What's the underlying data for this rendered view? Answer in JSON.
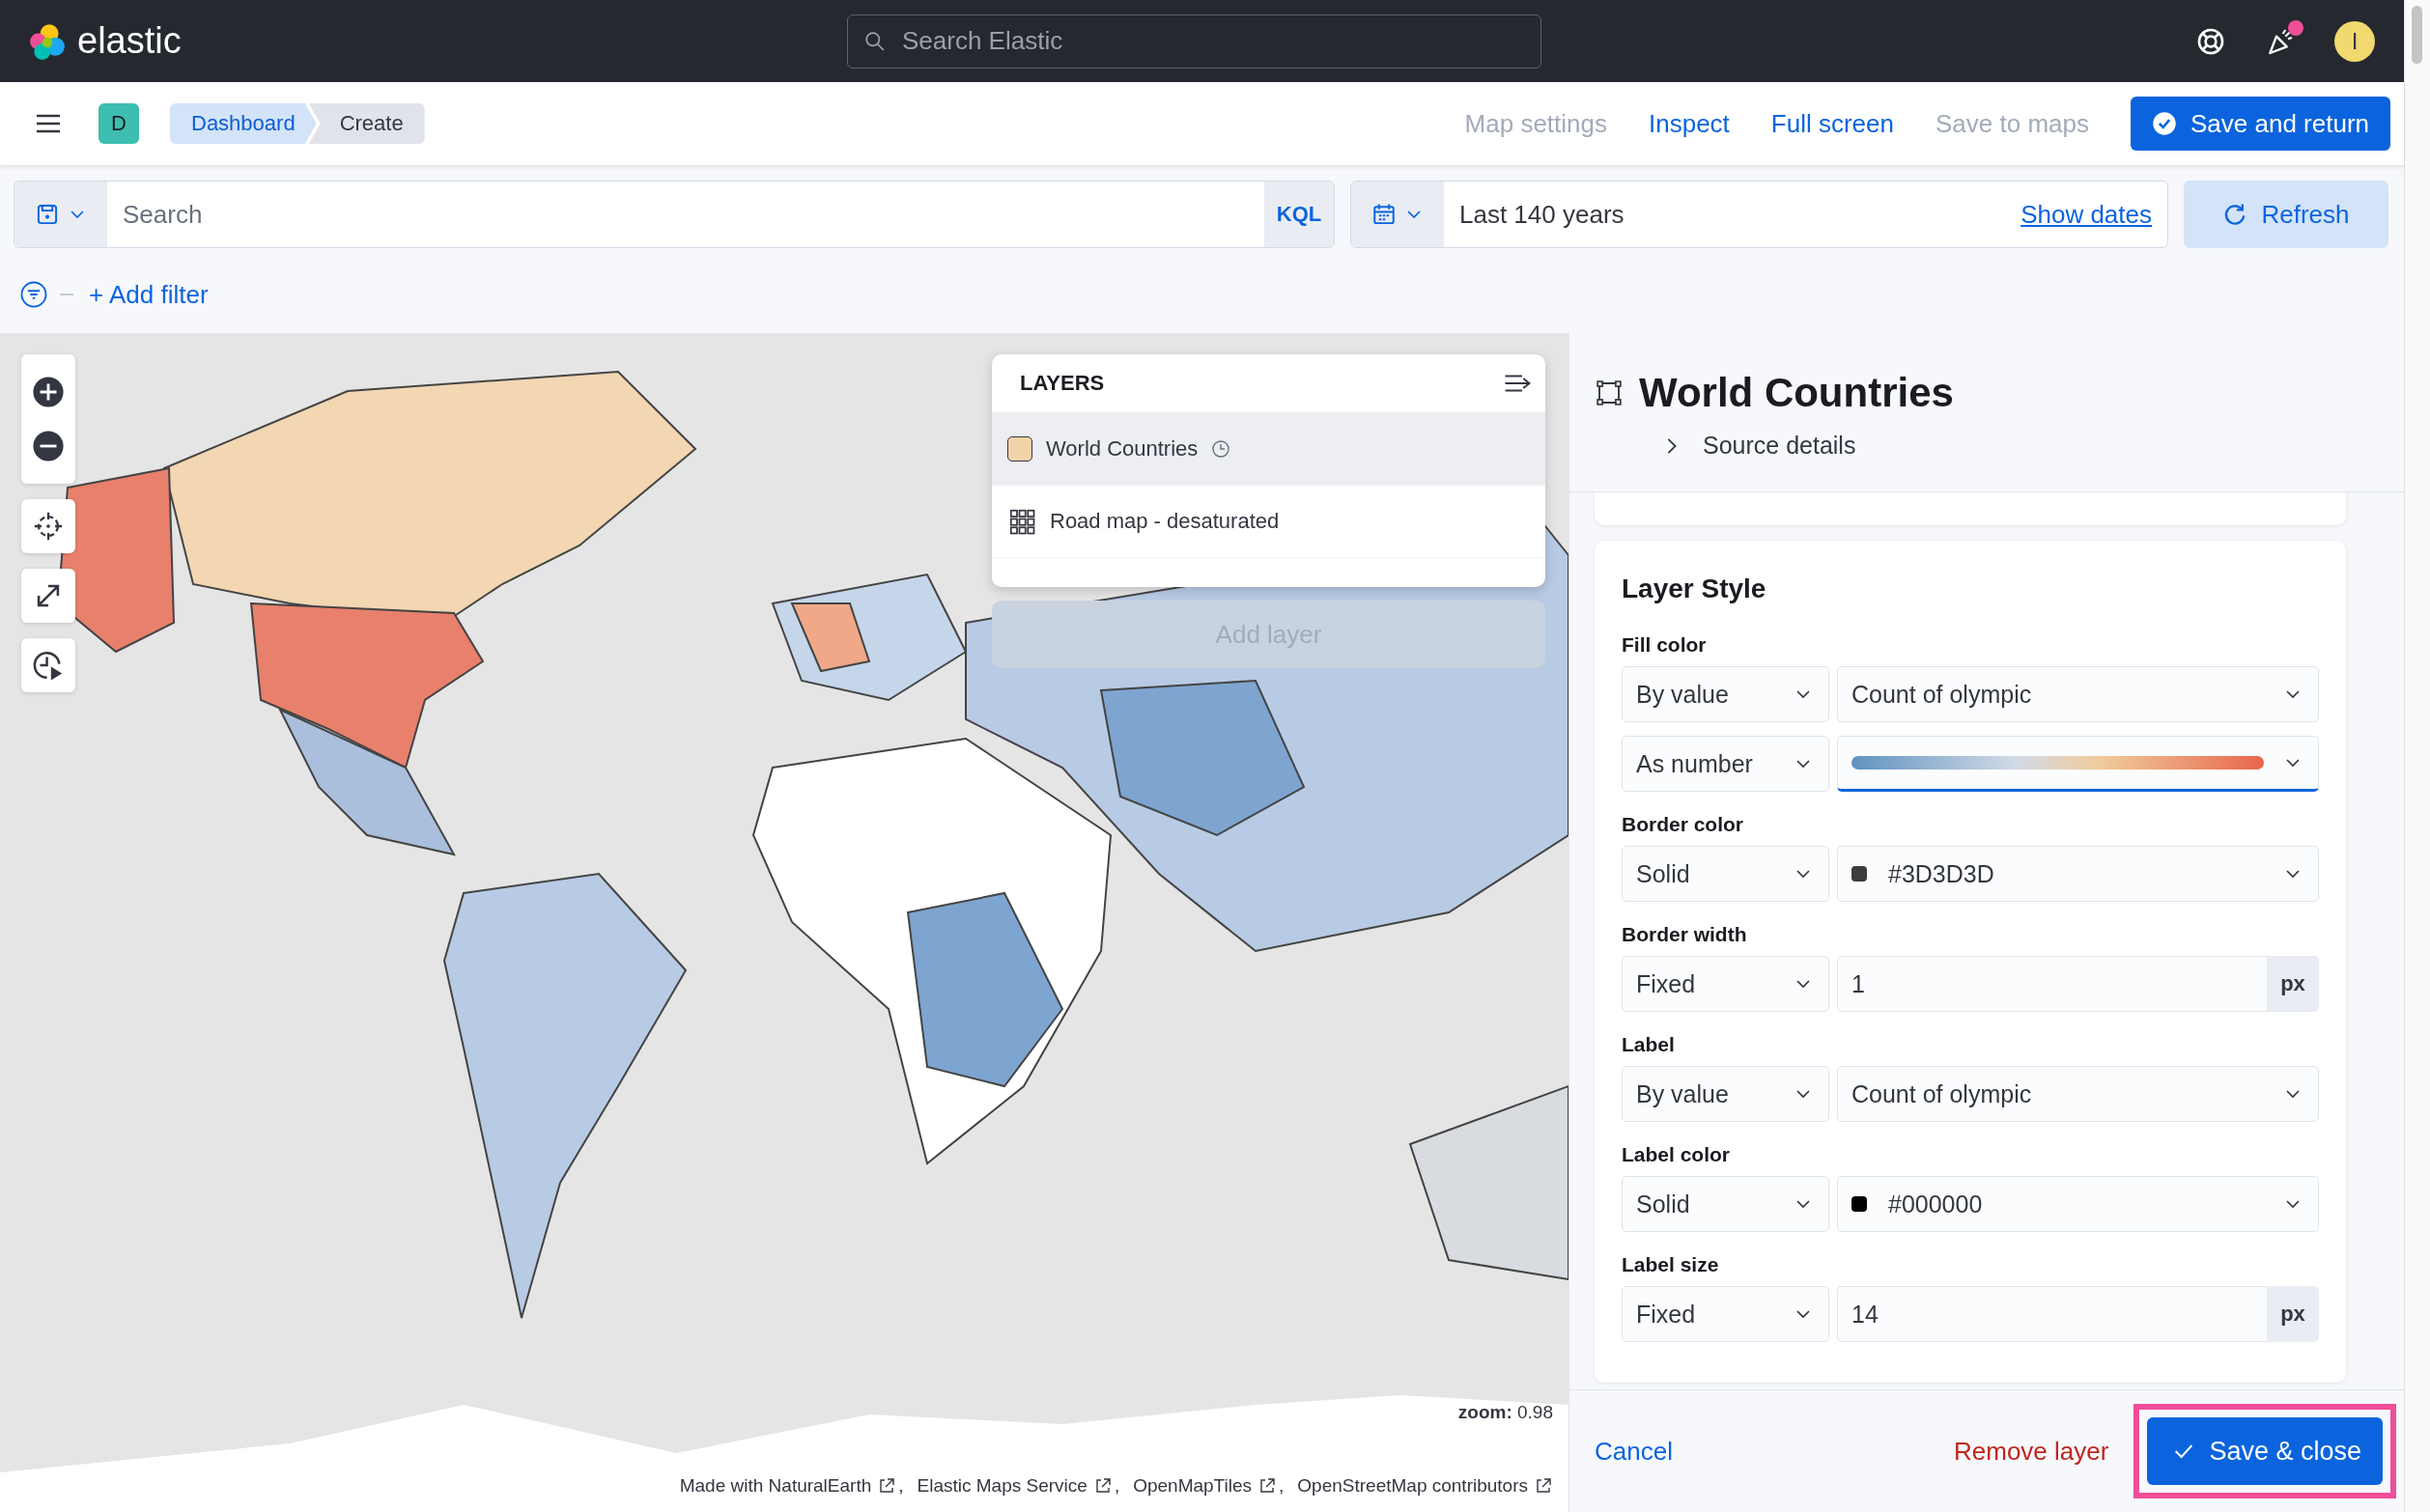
{
  "header": {
    "logo_text": "elastic",
    "search_placeholder": "Search Elastic",
    "notification_badge": true,
    "avatar_initial": "I"
  },
  "app_bar": {
    "space_initial": "D",
    "breadcrumbs": [
      {
        "label": "Dashboard",
        "selected": false
      },
      {
        "label": "Create",
        "selected": true
      }
    ],
    "actions": [
      {
        "label": "Map settings",
        "disabled": true
      },
      {
        "label": "Inspect",
        "disabled": false
      },
      {
        "label": "Full screen",
        "disabled": false
      },
      {
        "label": "Save to maps",
        "disabled": true
      }
    ],
    "primary_button": "Save and return"
  },
  "query_bar": {
    "placeholder": "Search",
    "language": "KQL",
    "time_range": "Last 140 years",
    "show_dates": "Show dates",
    "refresh": "Refresh"
  },
  "filters": {
    "add_filter": "+ Add filter"
  },
  "map": {
    "kind": "picture",
    "zoom_label": "zoom:",
    "zoom_value": "0.98",
    "attributions": [
      {
        "text": "Made with NaturalEarth",
        "separator": ","
      },
      {
        "text": "Elastic Maps Service",
        "separator": ","
      },
      {
        "text": "OpenMapTiles",
        "separator": ","
      },
      {
        "text": "OpenStreetMap contributors"
      }
    ]
  },
  "layers_panel": {
    "title": "LAYERS",
    "layers": [
      {
        "name": "World Countries",
        "kind": "vector",
        "selected": true,
        "color": "#f2d3a8"
      },
      {
        "name": "Road map - desaturated",
        "kind": "tiles",
        "selected": false
      }
    ],
    "add_layer": "Add layer",
    "add_layer_disabled": true
  },
  "editor": {
    "title": "World Countries",
    "source_details": "Source details",
    "expanded": false,
    "section_title": "Layer Style",
    "properties": [
      {
        "label": "Fill color",
        "rows": [
          {
            "mode": "By value",
            "kind": "select",
            "value": "Count of olympic"
          },
          {
            "mode": "As number",
            "kind": "ramp",
            "focused": true
          }
        ]
      },
      {
        "label": "Border color",
        "rows": [
          {
            "mode": "Solid",
            "kind": "color",
            "value": "#3D3D3D"
          }
        ]
      },
      {
        "label": "Border width",
        "rows": [
          {
            "mode": "Fixed",
            "kind": "number",
            "value": "1",
            "unit": "px"
          }
        ]
      },
      {
        "label": "Label",
        "rows": [
          {
            "mode": "By value",
            "kind": "select",
            "value": "Count of olympic"
          }
        ]
      },
      {
        "label": "Label color",
        "rows": [
          {
            "mode": "Solid",
            "kind": "color",
            "value": "#000000"
          }
        ]
      },
      {
        "label": "Label size",
        "rows": [
          {
            "mode": "Fixed",
            "kind": "number",
            "value": "14",
            "unit": "px"
          }
        ]
      }
    ],
    "footer": {
      "cancel": "Cancel",
      "remove": "Remove layer",
      "save": "Save & close"
    }
  }
}
